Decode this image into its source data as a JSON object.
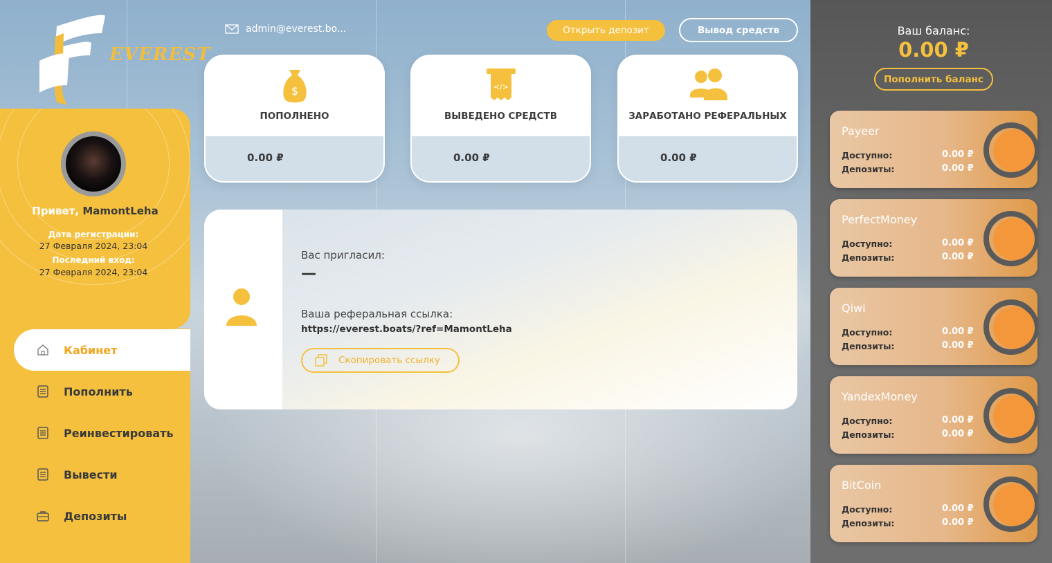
{
  "brand": {
    "name": "EVEREST",
    "accent": "#f5c03e"
  },
  "header": {
    "email": "admin@everest.bo...",
    "open_deposit": "Открыть депозит",
    "withdraw": "Вывод средств"
  },
  "profile": {
    "greeting": "Привет, ",
    "username": "MamontLeha",
    "reg_label": "Дата регистрации:",
    "reg_value": "27 Февраля 2024, 23:04",
    "last_label": "Последний вход:",
    "last_value": "27 Февраля 2024, 23:04"
  },
  "nav": {
    "items": [
      {
        "label": "Кабинет",
        "icon": "home-icon"
      },
      {
        "label": "Пополнить",
        "icon": "document-icon"
      },
      {
        "label": "Реинвестировать",
        "icon": "document-icon"
      },
      {
        "label": "Вывести",
        "icon": "document-icon"
      },
      {
        "label": "Депозиты",
        "icon": "briefcase-icon"
      }
    ]
  },
  "stats": [
    {
      "label": "ПОПОЛНЕНО",
      "value": "0.00 ₽",
      "icon": "money-bag-icon"
    },
    {
      "label": "ВЫВЕДЕНО СРЕДСТВ",
      "value": "0.00 ₽",
      "icon": "receipt-icon"
    },
    {
      "label": "ЗАРАБОТАНО РЕФЕРАЛЬНЫХ",
      "value": "0.00 ₽",
      "icon": "users-icon"
    }
  ],
  "referral": {
    "invited_label": "Вас пригласил:",
    "invited_value": "—",
    "link_label": "Ваша реферальная ссылка:",
    "link": "https://everest.boats/?ref=MamontLeha",
    "copy_button": "Скопировать ссылку"
  },
  "balance": {
    "label": "Ваш баланс:",
    "value": "0.00 ₽",
    "topup_button": "Пополнить баланс"
  },
  "wallets": {
    "available_label": "Доступно:",
    "deposits_label": "Депозиты:",
    "items": [
      {
        "name": "Payeer",
        "available": "0.00 ₽",
        "deposits": "0.00 ₽"
      },
      {
        "name": "PerfectMoney",
        "available": "0.00 ₽",
        "deposits": "0.00 ₽"
      },
      {
        "name": "Qiwi",
        "available": "0.00 ₽",
        "deposits": "0.00 ₽"
      },
      {
        "name": "YandexMoney",
        "available": "0.00 ₽",
        "deposits": "0.00 ₽"
      },
      {
        "name": "BitCoin",
        "available": "0.00 ₽",
        "deposits": "0.00 ₽"
      }
    ]
  }
}
